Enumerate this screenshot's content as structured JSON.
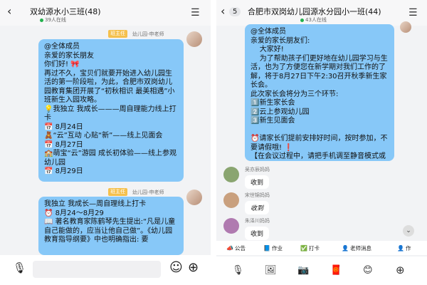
{
  "left": {
    "back_glyph": "‹",
    "title": "双幼源水小三班(48)",
    "online": "39人在线",
    "msg1": {
      "tag": "班主任",
      "sender": "幼儿园-申老师",
      "text": "@全体成员\n亲爱的家长朋友\n你们好! 🎀\n再过不久，宝贝们就要开始进入幼儿园生活的第一阶段啦，为此，合肥市双岗幼儿园教育集团开展了“初秋相识 最美相遇”小班新生入园攻略。\n💡我独立 我成长———周自理能力线上打卡\n📅 8月24日\n🧸“云”互动 心贴“新”——线上见面会\n📅 8月27日\n🏫萌宝“云”游园 成长初体验——线上参观幼儿园\n📅 8月29日"
    },
    "msg2": {
      "tag": "班主任",
      "sender": "幼儿园-申老师",
      "text": "我独立 我成长—周自理线上打卡\n⏰ 8月24～8月29\n📖 著名教育家陈鹤琴先生提出:“凡是儿童自己能做的，应当让他自己做”。《幼儿园教育指导纲要》中也明确指出: 要"
    }
  },
  "right": {
    "back_glyph": "‹",
    "unread": "5",
    "title": "合肥市双岗幼儿园源水分园小一班(44)",
    "online": "43人在线",
    "msg": {
      "text": "@全体成员\n亲爱的家长朋友们:\n    大家好!\n    为了帮助孩子们更好地在幼儿园学习与生活，也为了方便您在新学期对我们工作的了解，将于8月27日下午2:30召开秋季新生家长会。\n此次家长会将分为三个环节:\n1️⃣新生家长会\n2️⃣云上参观幼儿园\n3️⃣新生见面会\n\n⏰请家长们提前安排好时间，按时参加，不要请假哦! ❗\n【在会议过程中，请把手机调至静音模式或震动状态，进入会议后修改备注: 小一班*爸爸/妈妈】\n\n谢谢配合，收到请回复!"
    },
    "replies": [
      {
        "name": "吴亦辰妈妈",
        "text": "收到"
      },
      {
        "name": "宋世锦妈妈",
        "text": "收到"
      },
      {
        "name": "朱泽川妈妈",
        "text": "收到"
      }
    ],
    "tabs": [
      {
        "icon": "📣",
        "label": "公告"
      },
      {
        "icon": "📘",
        "label": "作业"
      },
      {
        "icon": "✅",
        "label": "打卡"
      },
      {
        "icon": "👤",
        "label": "老师消息"
      },
      {
        "icon": "👤",
        "label": "作"
      }
    ],
    "bottom_icons": [
      "🎙",
      "🖼",
      "📷",
      "🧧",
      "😊",
      "⊕"
    ]
  },
  "icons": {
    "menu": "☰",
    "voice": "🎙",
    "emoji": "☺",
    "plus": "⊕",
    "scroll": "⌄"
  }
}
